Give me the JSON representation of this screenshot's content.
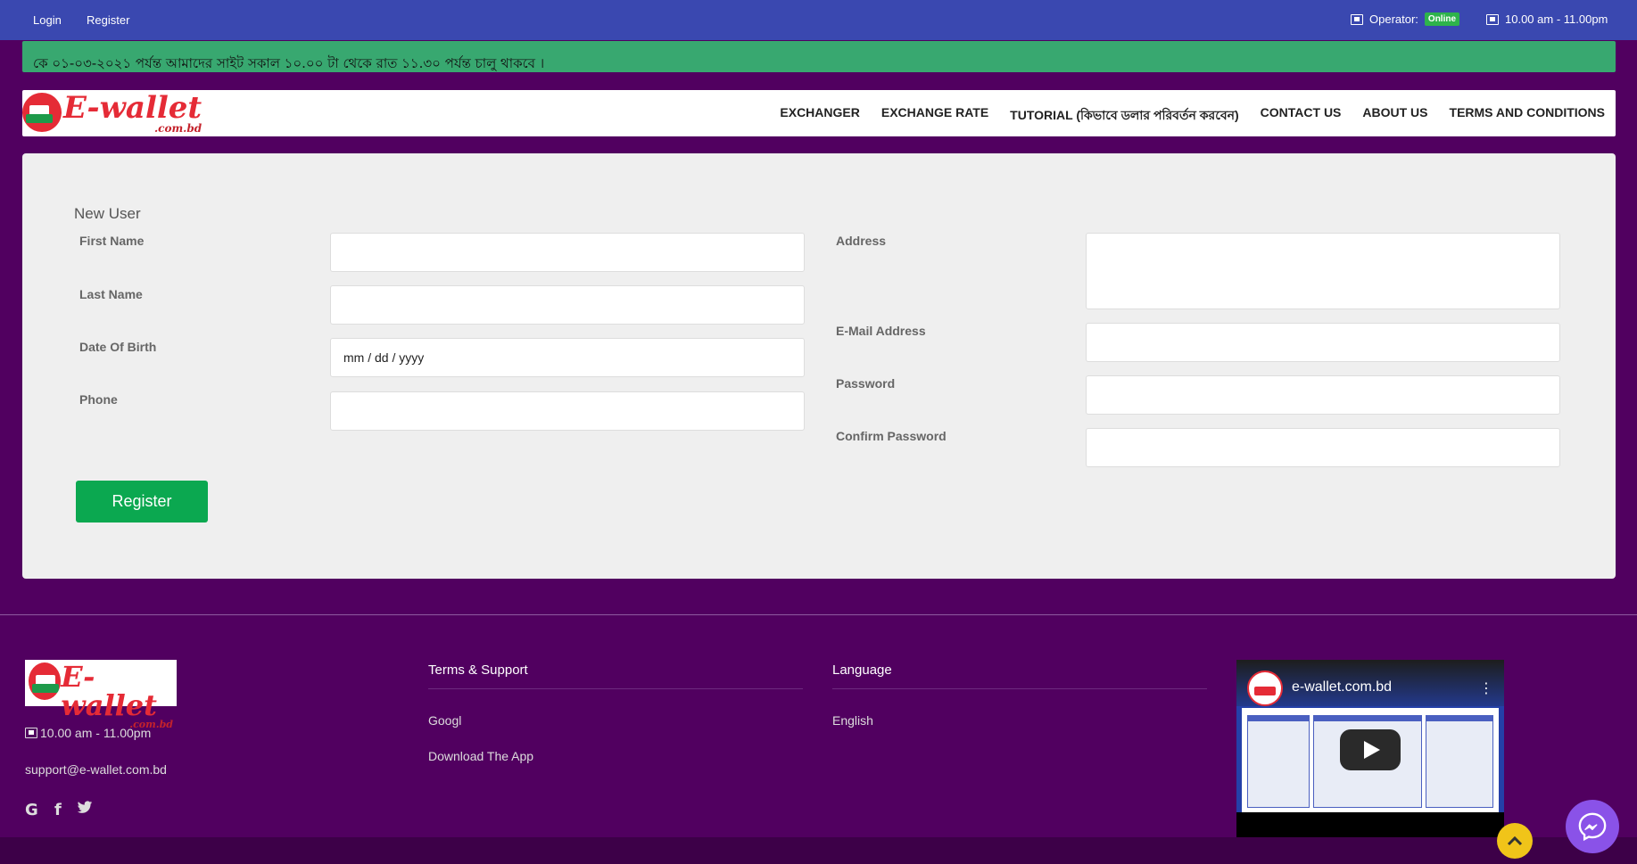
{
  "topbar": {
    "login": "Login",
    "register": "Register",
    "operator_label": "Operator:",
    "operator_status": "Online",
    "hours": "10.00 am - 11.00pm"
  },
  "notice": "কে ০১-০৩-২০২১ পর্যন্ত আমাদের সাইট সকাল ১০.০০ টা থেকে রাত ১১.৩০  পর্যন্ত চালু থাকবে ।",
  "brand": {
    "name": "E-wallet",
    "domain": ".com.bd"
  },
  "nav": {
    "items": [
      "EXCHANGER",
      "EXCHANGE RATE",
      "TUTORIAL (কিভাবে ডলার পরিবর্তন করবেন)",
      "CONTACT US",
      "ABOUT US",
      "TERMS AND CONDITIONS"
    ]
  },
  "form": {
    "title": "New User",
    "first_name": "First Name",
    "last_name": "Last Name",
    "dob": "Date Of Birth",
    "dob_value": "mm / dd / yyyy",
    "phone": "Phone",
    "address": "Address",
    "email": "E-Mail Address",
    "password": "Password",
    "confirm_password": "Confirm Password",
    "submit": "Register"
  },
  "footer": {
    "hours": "10.00 am - 11.00pm",
    "email": "support@e-wallet.com.bd",
    "social_icons": [
      "google-icon",
      "facebook-icon",
      "twitter-icon"
    ],
    "terms_heading": "Terms & Support",
    "terms_links": [
      "Googl",
      "Download The App"
    ],
    "language_heading": "Language",
    "language_links": [
      "English"
    ],
    "video_title": "e-wallet.com.bd"
  },
  "colors": {
    "background": "#510060",
    "topbar": "#3a48b0",
    "notice": "#38a870",
    "register_button": "#0ba850",
    "brand_red": "#e52b36",
    "brand_green": "#1e9a4a"
  }
}
